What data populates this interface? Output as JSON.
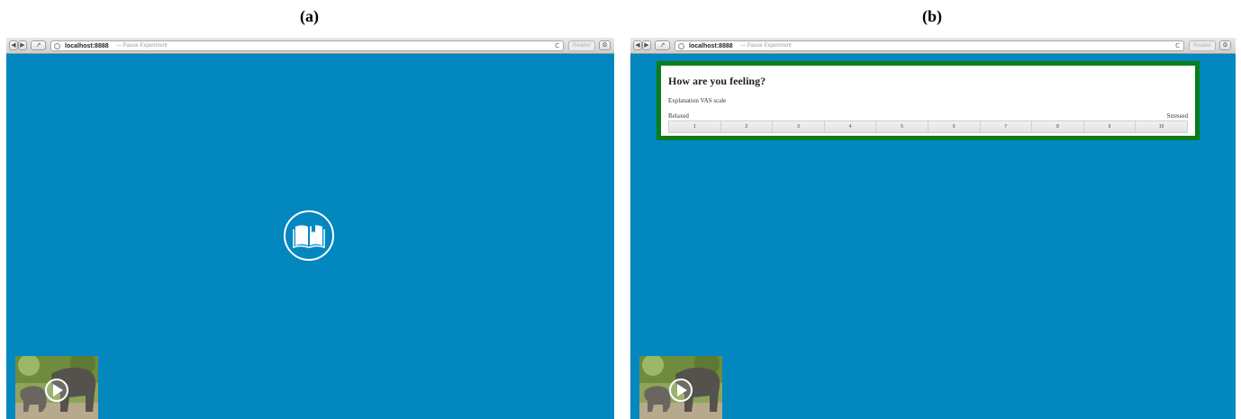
{
  "panels": [
    {
      "label": "(a)",
      "browser": {
        "host": "localhost:8888",
        "title": "— Pause Experiment",
        "reader": "Reader",
        "reload_glyph": "C"
      },
      "icons": {
        "center": "book-icon",
        "play": "play-icon"
      }
    },
    {
      "label": "(b)",
      "browser": {
        "host": "localhost:8888",
        "title": "— Pause Experiment",
        "reader": "Reader",
        "reload_glyph": "C"
      },
      "question": {
        "title": "How are you feeling?",
        "explanation": "Explanation VAS scale",
        "left_anchor": "Relaxed",
        "right_anchor": "Stressed",
        "scale": [
          "1",
          "2",
          "3",
          "4",
          "5",
          "6",
          "7",
          "8",
          "9",
          "10"
        ]
      },
      "icons": {
        "play": "play-icon"
      }
    }
  ],
  "colors": {
    "background": "#0287bf",
    "border_green": "#0a7d19"
  }
}
